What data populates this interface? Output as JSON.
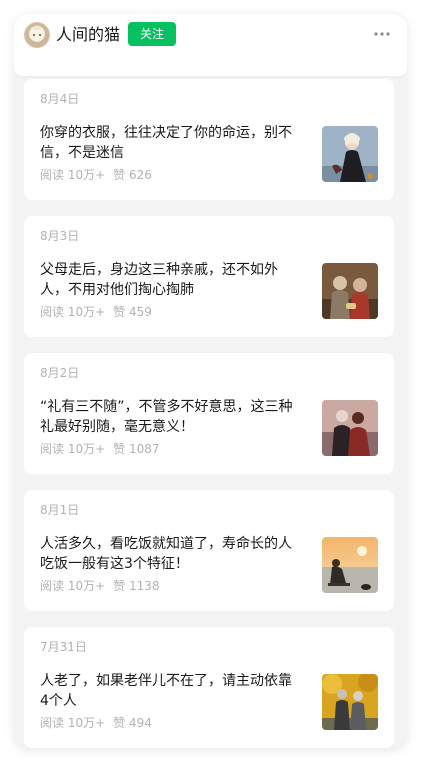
{
  "account": {
    "name": "人间的猫",
    "follow_label": "关注"
  },
  "articles": [
    {
      "date": "8月4日",
      "title": "你穿的衣服，往往决定了你的命运，别不信，不是迷信",
      "reads": "阅读 10万+",
      "likes": "赞 626",
      "thumb": "woman-in-dress-image"
    },
    {
      "date": "8月3日",
      "title": "父母走后，身边这三种亲戚，还不如外人，不用对他们掏心掏肺",
      "reads": "阅读 10万+",
      "likes": "赞 459",
      "thumb": "elderly-couple-image"
    },
    {
      "date": "8月2日",
      "title": "“礼有三不随”，不管多不好意思，这三种礼最好别随，毫无意义！",
      "reads": "阅读 10万+",
      "likes": "赞 1087",
      "thumb": "couple-sunset-image"
    },
    {
      "date": "8月1日",
      "title": "人活多久，看吃饭就知道了，寿命长的人吃饭一般有这3个特征！",
      "reads": "阅读 10万+",
      "likes": "赞 1138",
      "thumb": "man-by-lake-image"
    },
    {
      "date": "7月31日",
      "title": "人老了，如果老伴儿不在了，请主动依靠4个人",
      "reads": "阅读 10万+",
      "likes": "赞 494",
      "thumb": "old-couple-autumn-image"
    }
  ]
}
